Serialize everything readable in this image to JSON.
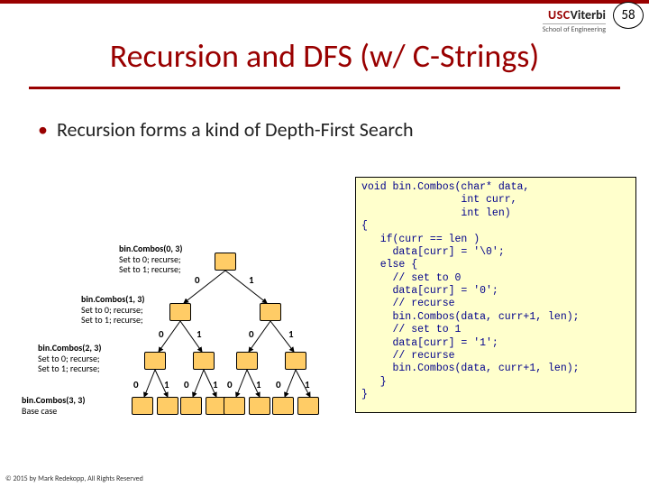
{
  "page_number": "58",
  "logo": {
    "usc": "USC",
    "viterbi": "Viterbi",
    "school": "School of Engineering"
  },
  "title": "Recursion and DFS (w/ C-Strings)",
  "bullet": "Recursion forms a kind of Depth-First Search",
  "code": "void bin.Combos(char* data,\n                int curr,\n                int len)\n{\n   if(curr == len )\n     data[curr] = '\\0';\n   else {\n     // set to 0\n     data[curr] = '0';\n     // recurse\n     bin.Combos(data, curr+1, len);\n     // set to 1\n     data[curr] = '1';\n     // recurse\n     bin.Combos(data, curr+1, len);\n   }\n}",
  "edges": {
    "l1a": "0",
    "l1b": "1",
    "l2a": "0",
    "l2b": "1",
    "l2c": "0",
    "l2d": "1",
    "l3a": "0",
    "l3b": "1",
    "l3c": "0",
    "l3d": "1",
    "l3e": "0",
    "l3f": "1",
    "l3g": "0",
    "l3h": "1"
  },
  "annotations": {
    "a0": {
      "head": "bin.Combos(0, 3)",
      "line1": "Set to 0; recurse;",
      "line2": "Set to 1; recurse;"
    },
    "a1": {
      "head": "bin.Combos(1, 3)",
      "line1": "Set to 0; recurse;",
      "line2": "Set to 1; recurse;"
    },
    "a2": {
      "head": "bin.Combos(2, 3)",
      "line1": "Set to 0; recurse;",
      "line2": "Set to 1; recurse;"
    },
    "a3": {
      "head": "bin.Combos(3, 3)",
      "line1": "Base case"
    }
  },
  "footer": "© 2015 by Mark Redekopp, All Rights Reserved"
}
